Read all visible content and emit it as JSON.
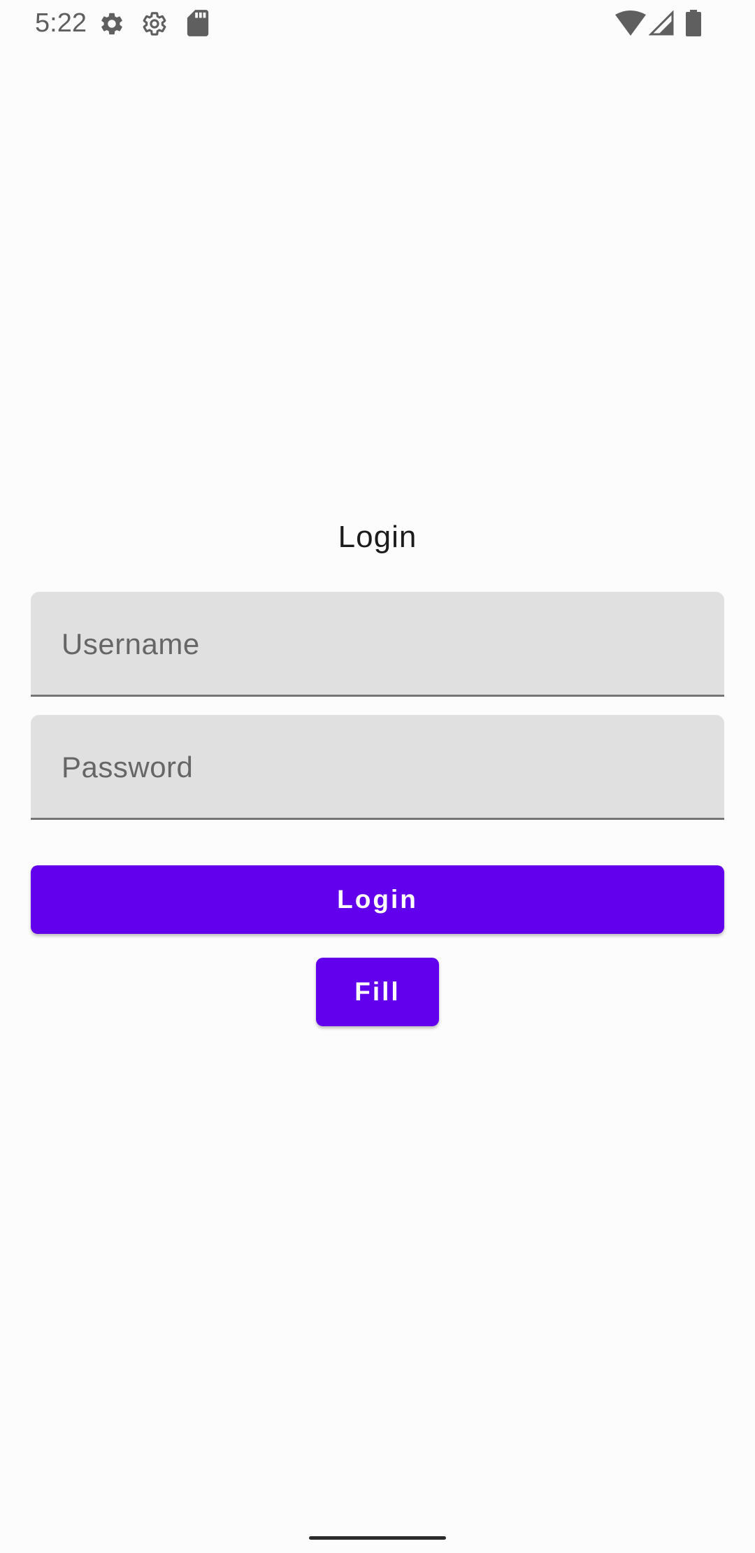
{
  "status_bar": {
    "time": "5:22",
    "icons_left": [
      "settings-icon",
      "settings-outline-icon",
      "sd-card-icon"
    ],
    "icons_right": [
      "wifi-icon",
      "signal-icon",
      "battery-icon"
    ]
  },
  "login": {
    "title": "Login",
    "username": {
      "value": "",
      "placeholder": "Username"
    },
    "password": {
      "value": "",
      "placeholder": "Password"
    },
    "login_button_label": "Login",
    "fill_button_label": "Fill"
  },
  "colors": {
    "primary": "#6200ee",
    "field_background": "#e0e0e0",
    "background": "#fdfcfc"
  }
}
